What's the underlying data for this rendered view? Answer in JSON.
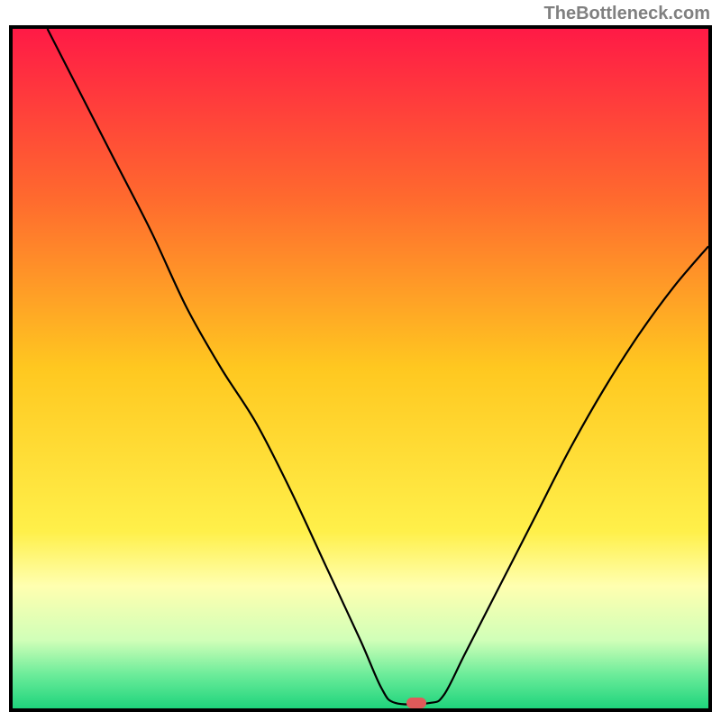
{
  "watermark": "TheBottleneck.com",
  "chart_data": {
    "type": "line",
    "title": "",
    "xlabel": "",
    "ylabel": "",
    "xlim": [
      0,
      100
    ],
    "ylim": [
      0,
      100
    ],
    "gradient_stops": [
      {
        "offset": 0,
        "color": "#ff1a46"
      },
      {
        "offset": 25,
        "color": "#ff6a2e"
      },
      {
        "offset": 50,
        "color": "#ffc820"
      },
      {
        "offset": 74,
        "color": "#fff04a"
      },
      {
        "offset": 82,
        "color": "#ffffb0"
      },
      {
        "offset": 90,
        "color": "#d0ffb8"
      },
      {
        "offset": 95,
        "color": "#6cec9a"
      },
      {
        "offset": 100,
        "color": "#1fd47c"
      }
    ],
    "series": [
      {
        "name": "bottleneck-curve",
        "points": [
          {
            "x": 5,
            "y": 100
          },
          {
            "x": 10,
            "y": 90
          },
          {
            "x": 15,
            "y": 80
          },
          {
            "x": 20,
            "y": 70
          },
          {
            "x": 25,
            "y": 59
          },
          {
            "x": 30,
            "y": 50
          },
          {
            "x": 35,
            "y": 42
          },
          {
            "x": 40,
            "y": 32
          },
          {
            "x": 45,
            "y": 21
          },
          {
            "x": 50,
            "y": 10
          },
          {
            "x": 53,
            "y": 3
          },
          {
            "x": 55,
            "y": 0.8
          },
          {
            "x": 60,
            "y": 0.8
          },
          {
            "x": 62,
            "y": 2
          },
          {
            "x": 65,
            "y": 8
          },
          {
            "x": 70,
            "y": 18
          },
          {
            "x": 75,
            "y": 28
          },
          {
            "x": 80,
            "y": 38
          },
          {
            "x": 85,
            "y": 47
          },
          {
            "x": 90,
            "y": 55
          },
          {
            "x": 95,
            "y": 62
          },
          {
            "x": 100,
            "y": 68
          }
        ]
      }
    ],
    "marker": {
      "x": 58,
      "y": 0.8
    }
  }
}
